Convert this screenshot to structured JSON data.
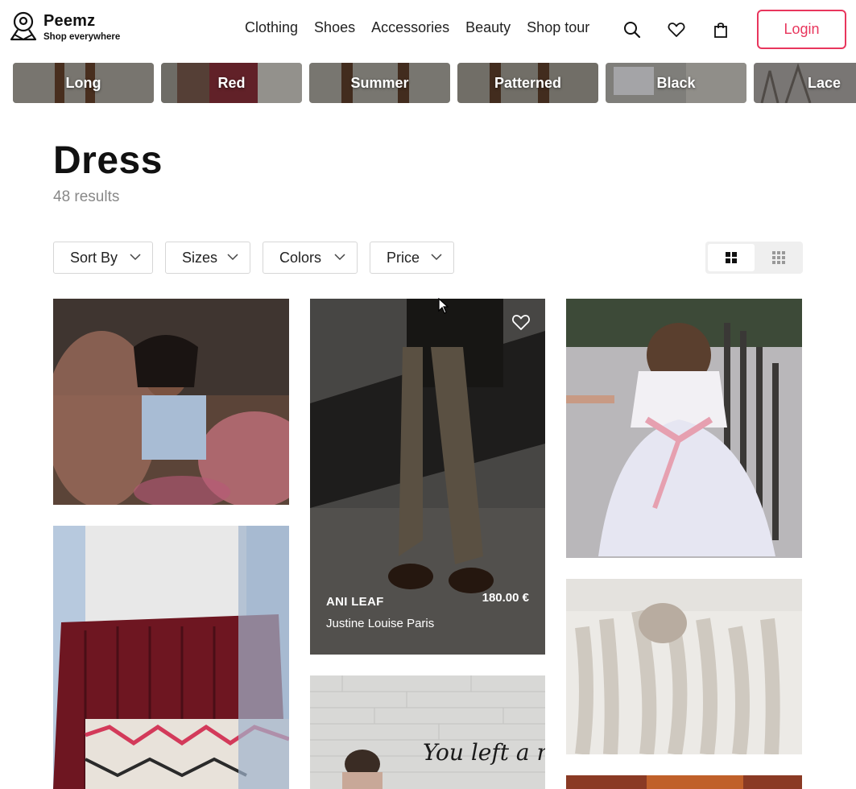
{
  "brand": {
    "name": "Peemz",
    "tagline": "Shop everywhere"
  },
  "nav": [
    "Clothing",
    "Shoes",
    "Accessories",
    "Beauty",
    "Shop tour"
  ],
  "header_icons": [
    "search-icon",
    "heart-icon",
    "shopping-bag-icon"
  ],
  "login_label": "Login",
  "categories": [
    "Long",
    "Red",
    "Summer",
    "Patterned",
    "Black",
    "Lace"
  ],
  "page": {
    "title": "Dress",
    "results": "48 results"
  },
  "filters": [
    "Sort By",
    "Sizes",
    "Colors",
    "Price"
  ],
  "view_modes": [
    "large-grid-icon",
    "small-grid-icon"
  ],
  "featured_product": {
    "brand": "ANI LEAF",
    "seller": "Justine Louise Paris",
    "price": "180.00 €"
  },
  "photo_text": "You left a ma",
  "colors": {
    "accent": "#e8365d"
  }
}
